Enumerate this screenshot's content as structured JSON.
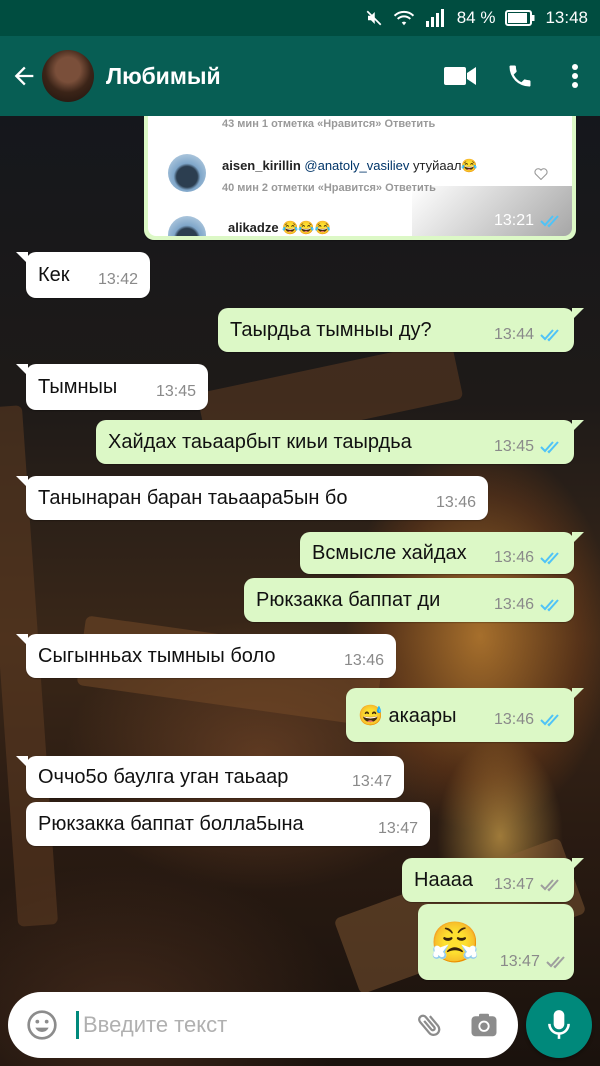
{
  "status_bar": {
    "battery_percent": "84 %",
    "time": "13:48",
    "icons": [
      "mute-icon",
      "wifi-icon",
      "signal-icon",
      "battery-icon"
    ]
  },
  "header": {
    "contact_name": "Любимый",
    "icons": [
      "back-arrow-icon",
      "video-call-icon",
      "phone-icon",
      "more-vert-icon"
    ]
  },
  "image_message": {
    "time": "13:21",
    "status": "read",
    "screenshot": {
      "line1_meta": "43 мин   1 отметка «Нравится»   Ответить",
      "comment_user": "aisen_kirillin",
      "comment_mention": "@anatoly_vasiliev",
      "comment_text": "утуйаал😂",
      "line2_meta": "40 мин   2 отметки «Нравится»   Ответить",
      "next_user": "alikadze",
      "next_text": "😂😂😂"
    }
  },
  "messages": [
    {
      "dir": "in",
      "text": "Кек",
      "time": "13:42"
    },
    {
      "dir": "out",
      "text": "Таырдьа тымныы ду?",
      "time": "13:44",
      "status": "read"
    },
    {
      "dir": "in",
      "text": "Тымныы",
      "time": "13:45"
    },
    {
      "dir": "out",
      "text": "Хайдах таьаарбыт киьи таырдьа",
      "time": "13:45",
      "status": "read"
    },
    {
      "dir": "in",
      "text": "Танынаран баран таьаара5ын бо",
      "time": "13:46"
    },
    {
      "dir": "out",
      "text": "Всмысле хайдах",
      "time": "13:46",
      "status": "read"
    },
    {
      "dir": "out",
      "text": "Рюкзакка баппат ди",
      "time": "13:46",
      "status": "read"
    },
    {
      "dir": "in",
      "text": "Сыгынньах тымныы боло",
      "time": "13:46"
    },
    {
      "dir": "out",
      "text": "😅 акаары",
      "time": "13:46",
      "status": "read"
    },
    {
      "dir": "in",
      "text": "Оччо5о баулга уган таьаар",
      "time": "13:47"
    },
    {
      "dir": "in",
      "text": "Рюкзакка баппат болла5ына",
      "time": "13:47"
    },
    {
      "dir": "out",
      "text": "Наааа",
      "time": "13:47",
      "status": "delivered"
    },
    {
      "dir": "out",
      "text": "😤",
      "time": "13:47",
      "status": "delivered"
    }
  ],
  "input": {
    "placeholder": "Введите текст",
    "value": ""
  },
  "colors": {
    "status_bar": "#004d40",
    "app_bar": "#075e54",
    "outgoing_bubble": "#dcf8c6",
    "incoming_bubble": "#ffffff",
    "read_ticks": "#4fc3f7",
    "delivered_ticks": "#9e9e9e",
    "mic_button": "#00897b"
  }
}
